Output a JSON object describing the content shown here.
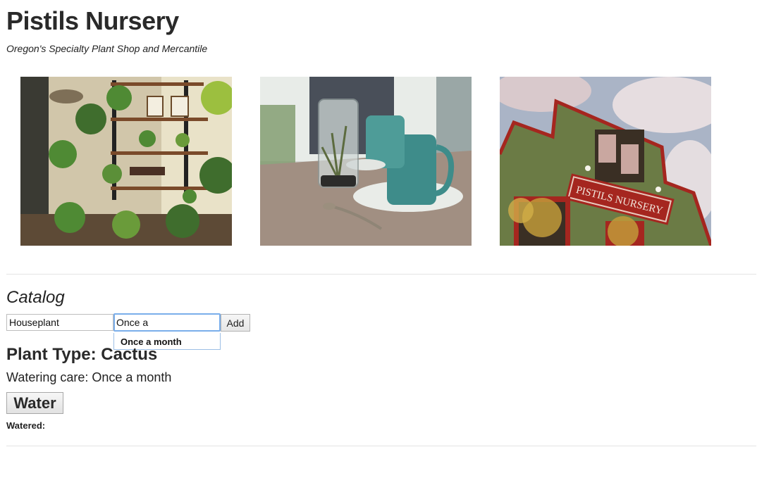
{
  "header": {
    "title": "Pistils Nursery",
    "tagline": "Oregon's Specialty Plant Shop and Mercantile"
  },
  "gallery": {
    "photos": [
      {
        "subject": "shop-interior-shelves-photo"
      },
      {
        "subject": "mugs-and-terrarium-photo"
      },
      {
        "subject": "storefront-facade-photo"
      }
    ],
    "storefront_sign": "PISTILS NURSERY"
  },
  "catalog": {
    "heading": "Catalog",
    "plant_type_input": {
      "value": "Houseplant",
      "placeholder": ""
    },
    "watering_input": {
      "value": "Once a",
      "placeholder": ""
    },
    "add_label": "Add",
    "suggestion": "Once a month"
  },
  "plant": {
    "type_line": "Plant Type: Cactus",
    "watering_line": "Watering care: Once a month",
    "water_label": "Water",
    "watered_line": "Watered:"
  },
  "colors": {
    "focus_ring": "#7aaeea",
    "divider": "#e4e4e4",
    "facade_green": "#6b7b45",
    "trim_red": "#a5261f"
  }
}
